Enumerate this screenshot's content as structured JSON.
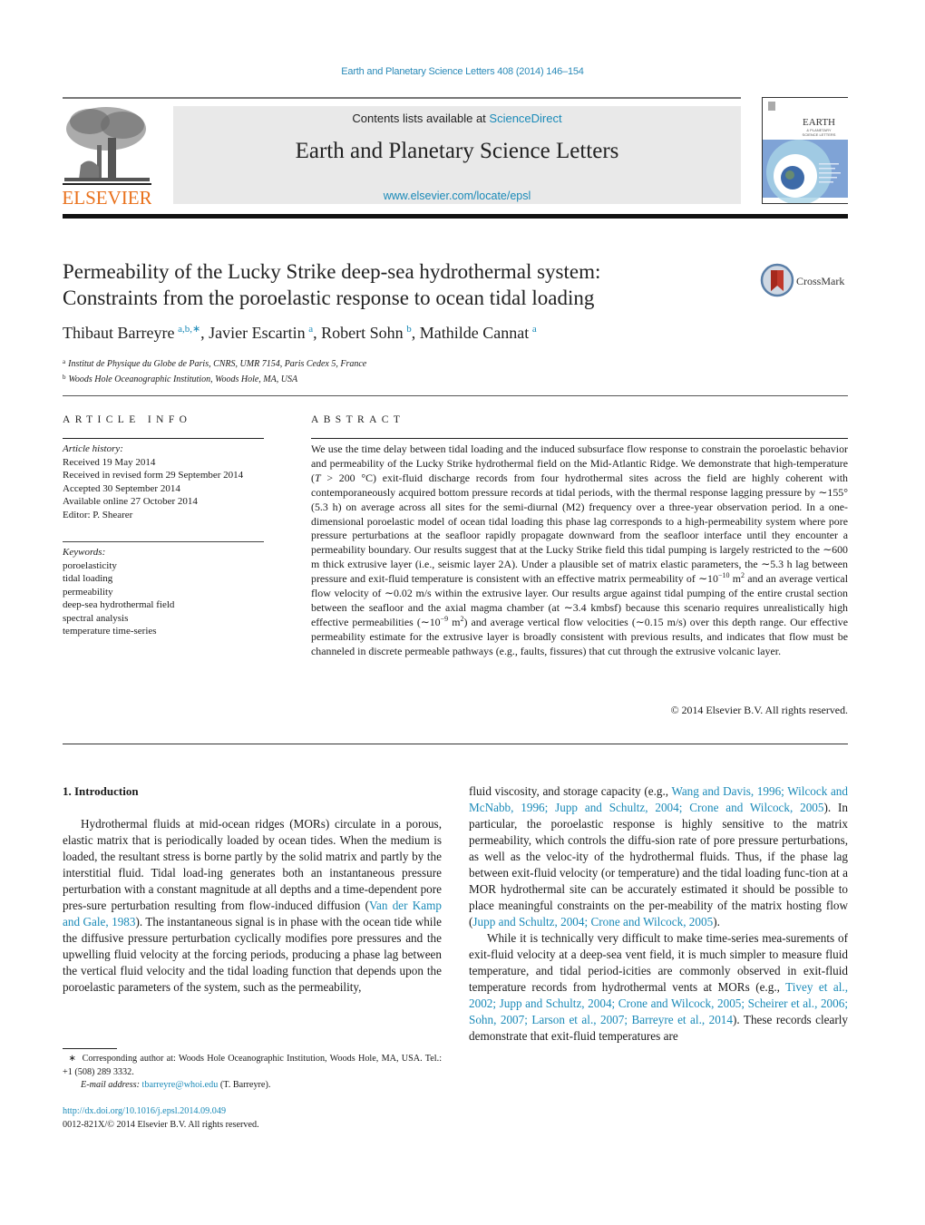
{
  "header": {
    "journal_ref": "Earth and Planetary Science Letters 408 (2014) 146–154",
    "contents_prefix": "Contents lists available at ",
    "contents_link": "ScienceDirect",
    "journal_name": "Earth and Planetary Science Letters",
    "journal_url": "www.elsevier.com/locate/epsl",
    "publisher_logo_text": "ELSEVIER",
    "cover_title_line1": "EARTH",
    "cover_title_line2": "& PLANETARY",
    "cover_title_line3": "SCIENCE LETTERS"
  },
  "article": {
    "title_line1": "Permeability of the Lucky Strike deep-sea hydrothermal system:",
    "title_line2": "Constraints from the poroelastic response to ocean tidal loading",
    "crossmark_label": "CrossMark",
    "authors": [
      {
        "name": "Thibaut Barreyre",
        "sup": "a,b,∗",
        "sep": ", "
      },
      {
        "name": "Javier Escartin",
        "sup": "a",
        "sep": ", "
      },
      {
        "name": "Robert Sohn",
        "sup": "b",
        "sep": ", "
      },
      {
        "name": "Mathilde Cannat",
        "sup": "a",
        "sep": ""
      }
    ],
    "affiliations": [
      {
        "key": "a",
        "text": "Institut de Physique du Globe de Paris, CNRS, UMR 7154, Paris Cedex 5, France"
      },
      {
        "key": "b",
        "text": "Woods Hole Oceanographic Institution, Woods Hole, MA, USA"
      }
    ]
  },
  "article_info": {
    "heading": "ARTICLE INFO",
    "history_label": "Article history:",
    "history": [
      "Received 19 May 2014",
      "Received in revised form 29 September 2014",
      "Accepted 30 September 2014",
      "Available online 27 October 2014",
      "Editor: P. Shearer"
    ],
    "keywords_label": "Keywords:",
    "keywords": [
      "poroelasticity",
      "tidal loading",
      "permeability",
      "deep-sea hydrothermal field",
      "spectral analysis",
      "temperature time-series"
    ]
  },
  "abstract": {
    "heading": "ABSTRACT",
    "p1": "We use the time delay between tidal loading and the induced subsurface flow response to constrain the poroelastic behavior and permeability of the Lucky Strike hydrothermal field on the Mid-Atlantic Ridge. We demonstrate that high-temperature (",
    "T": "T",
    "p2": " > 200 °C) exit-fluid discharge records from four hydrothermal sites across the field are highly coherent with contemporaneously acquired bottom pressure records at tidal periods, with the thermal response lagging pressure by ∼155° (5.3 h) on average across all sites for the semi-diurnal (M2) frequency over a three-year observation period. In a one-dimensional poroelastic model of ocean tidal loading this phase lag corresponds to a high-permeability system where pore pressure perturbations at the seafloor rapidly propagate downward from the seafloor interface until they encounter a permeability boundary. Our results suggest that at the Lucky Strike field this tidal pumping is largely restricted to the ∼600 m thick extrusive layer (i.e., seismic layer 2A). Under a plausible set of matrix elastic parameters, the ∼5.3 h lag between pressure and exit-fluid temperature is consistent with an effective matrix permeability of ∼10",
    "exp1": "−10",
    "p3": " m",
    "sq1": "2",
    "p4": " and an average vertical flow velocity of ∼0.02 m/s within the extrusive layer. Our results argue against tidal pumping of the entire crustal section between the seafloor and the axial magma chamber (at ∼3.4 kmbsf) because this scenario requires unrealistically high effective permeabilities (∼10",
    "exp2": "−9",
    "p5": " m",
    "sq2": "2",
    "p6": ") and average vertical flow velocities (∼0.15 m/s) over this depth range. Our effective permeability estimate for the extrusive layer is broadly consistent with previous results, and indicates that flow must be channeled in discrete permeable pathways (e.g., faults, fissures) that cut through the extrusive volcanic layer.",
    "copyright": "© 2014 Elsevier B.V. All rights reserved."
  },
  "body": {
    "section_heading": "1. Introduction",
    "left_p1_a": "Hydrothermal fluids at mid-ocean ridges (MORs) circulate in a porous, elastic matrix that is periodically loaded by ocean tides. When the medium is loaded, the resultant stress is borne partly by the solid matrix and partly by the interstitial fluid. Tidal load-ing generates both an instantaneous pressure perturbation with a constant magnitude at all depths and a time-dependent pore pres-sure perturbation resulting from flow-induced diffusion (",
    "left_cite1": "Van der Kamp and Gale, 1983",
    "left_p1_b": "). The instantaneous signal is in phase with the ocean tide while the diffusive pressure perturbation cyclically modifies pore pressures and the upwelling fluid velocity at the forcing periods, producing a phase lag between the vertical fluid velocity and the tidal loading function that depends upon the poroelastic parameters of the system, such as the permeability,",
    "right_p1_a": "fluid viscosity, and storage capacity (e.g., ",
    "right_cite1": "Wang and Davis, 1996; Wilcock and McNabb, 1996; Jupp and Schultz, 2004; Crone and Wilcock, 2005",
    "right_p1_b": "). In particular, the poroelastic response is highly sensitive to the matrix permeability, which controls the diffu-sion rate of pore pressure perturbations, as well as the veloc-ity of the hydrothermal fluids. Thus, if the phase lag between exit-fluid velocity (or temperature) and the tidal loading func-tion at a MOR hydrothermal site can be accurately estimated it should be possible to place meaningful constraints on the per-meability of the matrix hosting flow (",
    "right_cite2": "Jupp and Schultz, 2004; Crone and Wilcock, 2005",
    "right_p1_c": ").",
    "right_p2_a": "While it is technically very difficult to make time-series mea-surements of exit-fluid velocity at a deep-sea vent field, it is much simpler to measure fluid temperature, and tidal period-icities are commonly observed in exit-fluid temperature records from hydrothermal vents at MORs (e.g., ",
    "right_cite3": "Tivey et al., 2002; Jupp and Schultz, 2004; Crone and Wilcock, 2005; Scheirer et al., 2006; Sohn, 2007; Larson et al., 2007; Barreyre et al., 2014",
    "right_p2_b": "). These records clearly demonstrate that exit-fluid temperatures are"
  },
  "footnote": {
    "star": "∗",
    "corresponding": "Corresponding author at: Woods Hole Oceanographic Institution, Woods Hole, MA, USA. Tel.: +1 (508) 289 3332.",
    "email_label": "E-mail address: ",
    "email": "tbarreyre@whoi.edu",
    "email_suffix": " (T. Barreyre).",
    "doi": "http://dx.doi.org/10.1016/j.epsl.2014.09.049",
    "issn_copyright": "0012-821X/© 2014 Elsevier B.V. All rights reserved."
  },
  "colors": {
    "link": "#1a8ab8",
    "elsevier_orange": "#e9711c",
    "banner_gray": "#e9e9e9",
    "cover_blue": "#7fa3d6"
  }
}
